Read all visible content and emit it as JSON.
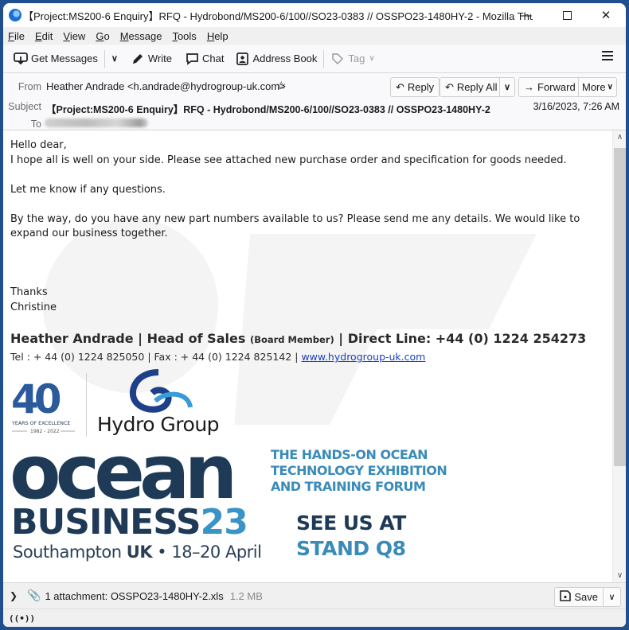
{
  "window": {
    "title": "【Project:MS200-6 Enquiry】RFQ - Hydrobond/MS200-6/100//SO23-0383 // OSSPO23-1480HY-2 - Mozilla Thun...",
    "controls": {
      "minimize": "—",
      "maximize": "",
      "close": "✕"
    }
  },
  "menu": [
    "File",
    "Edit",
    "View",
    "Go",
    "Message",
    "Tools",
    "Help"
  ],
  "toolbar": {
    "get_messages": "Get Messages",
    "write": "Write",
    "chat": "Chat",
    "address_book": "Address Book",
    "tag": "Tag"
  },
  "header": {
    "from_label": "From",
    "from_value": "Heather Andrade <h.andrade@hydrogroup-uk.com>",
    "subject_label": "Subject",
    "subject_value": "【Project:MS200-6 Enquiry】RFQ - Hydrobond/MS200-6/100//SO23-0383 // OSSPO23-1480HY-2",
    "to_label": "To",
    "date": "3/16/2023, 7:26 AM",
    "buttons": {
      "reply": "Reply",
      "reply_all": "Reply All",
      "forward": "Forward",
      "more": "More"
    }
  },
  "body": {
    "greeting": "Hello dear,",
    "line1": "I hope all is well on your side.  Please see attached new purchase order and specification for goods needed.",
    "line2": "Let me know if any questions.",
    "line3": "By the way, do you have any new part numbers available to us?  Please send me any details.  We would like to expand our business together.",
    "closing": "Thanks",
    "closing_name": "Christine",
    "signature": {
      "name_title": "Heather Andrade | Head of Sales ",
      "board": "(Board Member)",
      "direct": " | Direct Line: +44 (0) 1224 254273",
      "contact": "Tel : + 44 (0) 1224 825050 | Fax : + 44 (0) 1224 825142 | ",
      "website": "www.hydrogroup-uk.com"
    },
    "logos": {
      "forty_number": "40",
      "forty_caption": "YEARS OF EXCELLENCE",
      "forty_years": "1982 - 2022",
      "hydro_name": "Hydro Group"
    },
    "banner": {
      "ocean": "ocean",
      "business": "BUSINESS",
      "business_year": "23",
      "location_prefix": "Southampton ",
      "location_country": "UK",
      "location_suffix": " • 18–20 April",
      "tagline1": "THE HANDS-ON OCEAN",
      "tagline2": "TECHNOLOGY EXHIBITION",
      "tagline3": "AND TRAINING FORUM",
      "see_us": "SEE US AT",
      "stand": "STAND Q8"
    }
  },
  "attachment": {
    "summary": "1 attachment: OSSPO23-1480HY-2.xls",
    "size": "1.2 MB",
    "save": "Save"
  },
  "colors": {
    "window_frame": "#1f4f8c",
    "link": "#1a3fc0",
    "ocean_navy": "#1f3a56",
    "ocean_blue": "#3a8bb8"
  }
}
